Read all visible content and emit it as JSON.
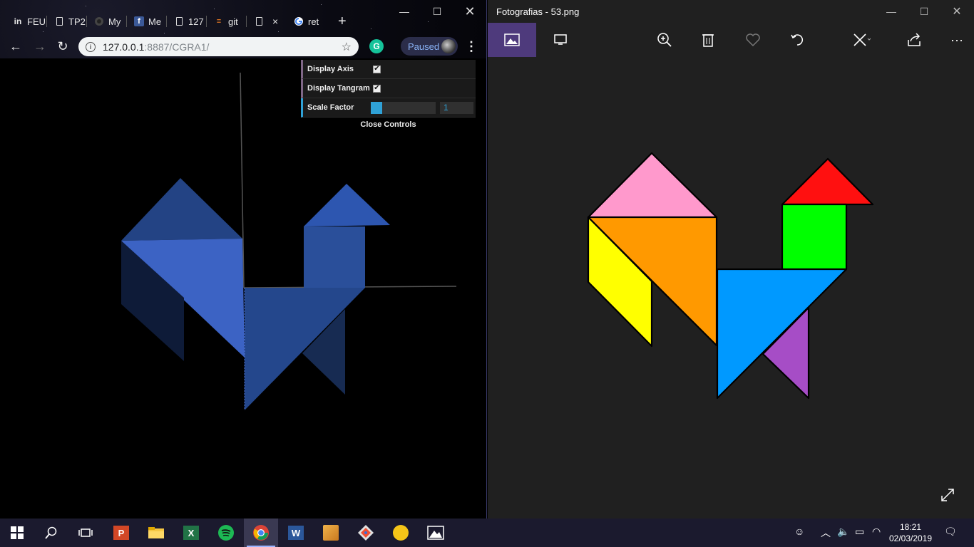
{
  "chrome": {
    "tabs": [
      {
        "label": "FEU",
        "icon": "feup-icon"
      },
      {
        "label": "TP2",
        "icon": "document-icon"
      },
      {
        "label": "My",
        "icon": "github-icon"
      },
      {
        "label": "Me",
        "icon": "facebook-icon"
      },
      {
        "label": "127",
        "icon": "document-icon"
      },
      {
        "label": "git",
        "icon": "stackoverflow-icon"
      },
      {
        "label": "",
        "icon": "document-icon",
        "active": true
      },
      {
        "label": "ret",
        "icon": "google-icon"
      }
    ],
    "new_tab_label": "+",
    "url_host": "127.0.0.1",
    "url_rest": ":8887/CGRA1/",
    "profile_label": "Paused",
    "gui": {
      "display_axis_label": "Display Axis",
      "display_axis_checked": true,
      "display_tangram_label": "Display Tangram",
      "display_tangram_checked": true,
      "scale_factor_label": "Scale Factor",
      "scale_factor_value": "1",
      "scale_factor_fraction": 0.18,
      "close_label": "Close Controls"
    },
    "scene_colors": {
      "light": "#3c63c4",
      "mid": "#2a4f9a",
      "dark": "#172b52",
      "darker": "#0e1b38"
    }
  },
  "photos": {
    "title": "Fotografias - 53.png",
    "toolbar": [
      "photo-view-icon",
      "slideshow-icon",
      "zoom-in-icon",
      "delete-icon",
      "favorite-icon",
      "rotate-icon",
      "edit-icon",
      "share-icon",
      "more-icon"
    ],
    "tangram_colors": {
      "pink": "#ff99cc",
      "orange": "#ff9900",
      "yellow": "#ffff00",
      "blue": "#0099ff",
      "purple": "#a64dc6",
      "green": "#00ff00",
      "red": "#ff1010"
    }
  },
  "taskbar": {
    "time": "18:21",
    "date": "02/03/2019"
  }
}
